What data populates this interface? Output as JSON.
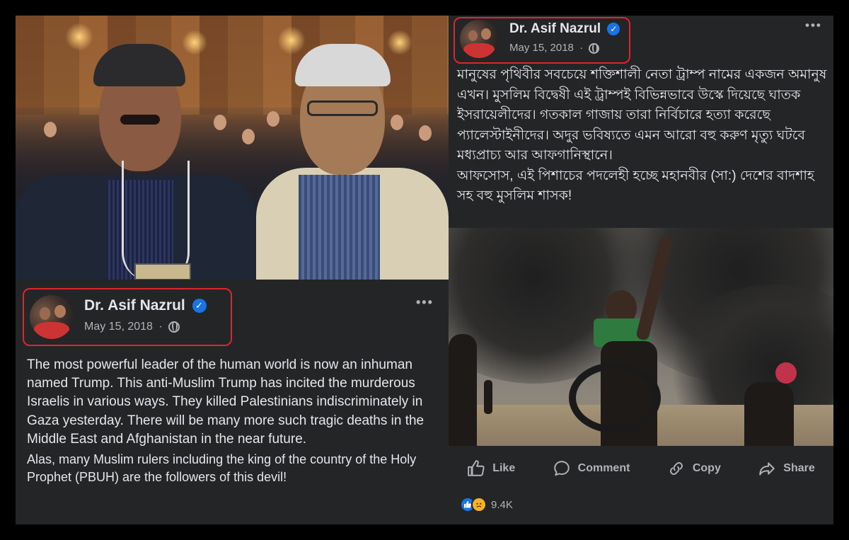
{
  "left_post": {
    "author": "Dr. Asif Nazrul",
    "verified_icon": "verified-badge-icon",
    "date": "May 15, 2018",
    "privacy_icon": "globe-icon",
    "more": "•••",
    "paragraphs": [
      "The most powerful leader of the human world is now an inhuman named Trump. This anti-Muslim Trump has incited the murderous Israelis in various ways. They killed Palestinians indiscriminately in Gaza yesterday. There will be many more such tragic deaths in the Middle East and Afghanistan in the near future.",
      "Alas, many Muslim rulers including the king of the country of the Holy Prophet (PBUH) are the followers of this devil!"
    ]
  },
  "right_post": {
    "author": "Dr. Asif Nazrul",
    "verified_icon": "verified-badge-icon",
    "date": "May 15, 2018",
    "privacy_icon": "globe-icon",
    "more": "•••",
    "paragraphs": [
      "মানুষের পৃথিবীর সবচেয়ে শক্তিশালী নেতা ট্রাম্প নামের একজন অমানুষ এখন। মুসলিম বিদ্বেষী এই ট্রাম্পই বিভিন্নভাবে উস্কে দিয়েছে ঘাতক ইসরায়েলীদের। গতকাল গাজায় তারা নির্বিচারে হত্যা করেছে প্যালেস্টাইনীদের। অদুর ভবিষ্যতে এমন আরো বহু করুণ মৃত্যু ঘটবে মধ্যপ্রাচ্য আর আফগানিস্থানে।",
      "আফসোস, এই পিশাচের পদলেহী হচ্ছে মহানবীর (সা:) দেশের বাদশাহ সহ বহু মুসলিম শাসক!"
    ],
    "actions": {
      "like": "Like",
      "comment": "Comment",
      "copy": "Copy",
      "share": "Share"
    },
    "reaction_count": "9.4K"
  },
  "colors": {
    "card_bg": "#242526",
    "text": "#e4e6eb",
    "secondary": "#b0b3b8",
    "highlight_border": "#e0242b",
    "verified": "#1b74e4"
  }
}
